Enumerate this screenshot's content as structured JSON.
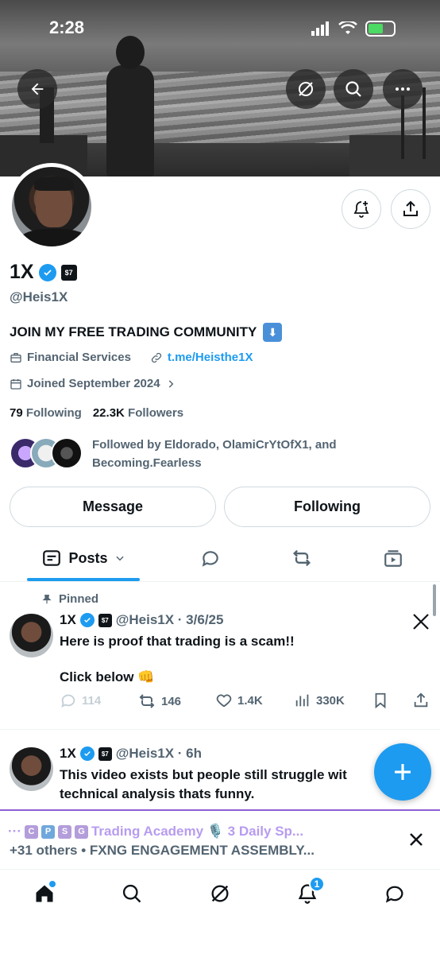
{
  "status_bar": {
    "time": "2:28"
  },
  "profile": {
    "name": "1X",
    "handle": "@Heis1X",
    "bio": "JOIN MY FREE TRADING COMMUNITY",
    "bio_emoji": "⬇",
    "category": "Financial Services",
    "link": "t.me/Heisthe1X",
    "joined": "Joined September 2024",
    "following_count": "79",
    "following_label": "Following",
    "followers_count": "22.3K",
    "followers_label": "Followers",
    "followed_by": "Followed by Eldorado, OlamiCrYtOfX1, and Becoming.Fearless"
  },
  "buttons": {
    "message": "Message",
    "following": "Following"
  },
  "tabs": {
    "posts": "Posts"
  },
  "pinned_label": "Pinned",
  "posts": [
    {
      "name": "1X",
      "meta": "@Heis1X · 3/6/25",
      "line1": "Here is proof that trading is a scam!!",
      "line2": "Click below 👊",
      "replies": "114",
      "reposts": "146",
      "likes": "1.4K",
      "views": "330K"
    },
    {
      "name": "1X",
      "meta": "@Heis1X · 6h",
      "line1": "This video exists but people still struggle wit",
      "line2": "technical analysis thats funny."
    }
  ],
  "spaces": {
    "title": "Trading Academy 🎙️ 3 Daily Sp...",
    "subtitle": "+31 others • FXNG ENGAGEMENT ASSEMBLY..."
  },
  "notifications_badge": "1",
  "colors": {
    "accent": "#1d9bf0",
    "spaces": "#8e5fd4"
  }
}
